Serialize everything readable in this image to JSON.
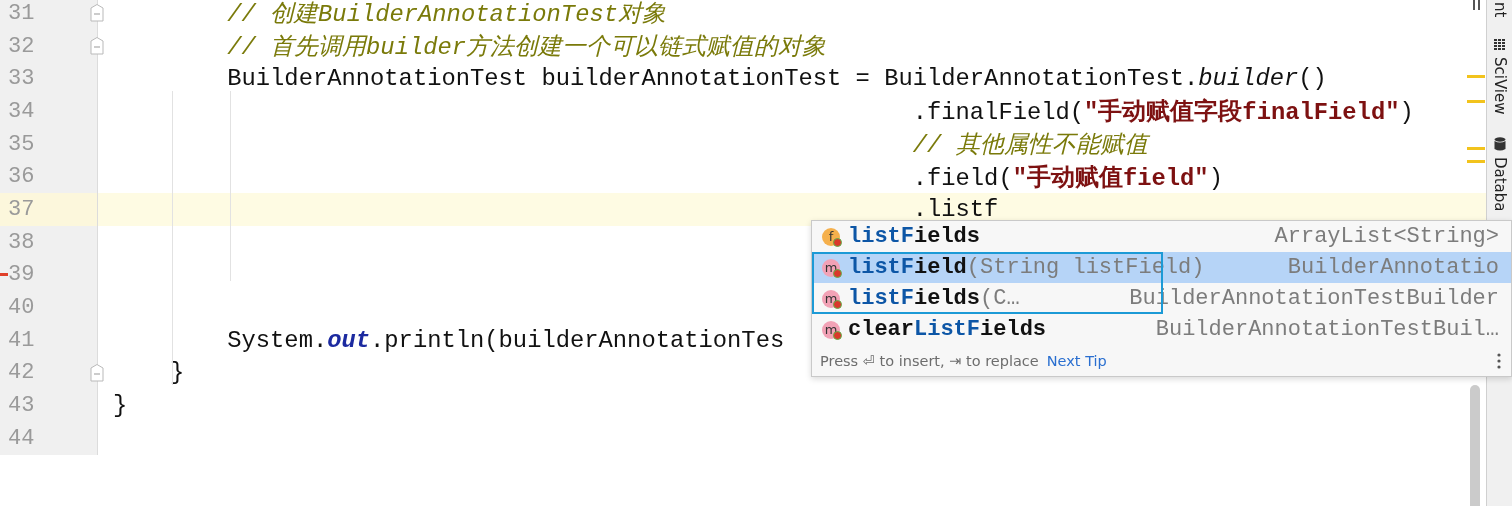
{
  "editor": {
    "lines": [
      {
        "number": "31",
        "current": false,
        "fold_marker": true,
        "change_marker": false,
        "tokens": [
          {
            "kind": "comment",
            "text": "        // 创建BuilderAnnotationTest对象"
          }
        ]
      },
      {
        "number": "32",
        "current": false,
        "fold_marker": true,
        "change_marker": false,
        "tokens": [
          {
            "kind": "comment",
            "text": "        // 首先调用builder方法创建一个可以链式赋值的对象"
          }
        ]
      },
      {
        "number": "33",
        "current": false,
        "fold_marker": false,
        "change_marker": false,
        "tokens": [
          {
            "kind": "plain",
            "text": "        BuilderAnnotationTest builderAnnotationTest = BuilderAnnotationTest."
          },
          {
            "kind": "method",
            "text": "builder"
          },
          {
            "kind": "plain",
            "text": "()"
          }
        ]
      },
      {
        "number": "34",
        "current": false,
        "fold_marker": false,
        "change_marker": false,
        "tokens": [
          {
            "kind": "plain",
            "text": "                                                        .finalField("
          },
          {
            "kind": "string",
            "text": "\"手动赋值字段finalField\""
          },
          {
            "kind": "plain",
            "text": ")"
          }
        ]
      },
      {
        "number": "35",
        "current": false,
        "fold_marker": false,
        "change_marker": false,
        "tokens": [
          {
            "kind": "comment",
            "text": "                                                        // 其他属性不能赋值"
          }
        ]
      },
      {
        "number": "36",
        "current": false,
        "fold_marker": false,
        "change_marker": false,
        "tokens": [
          {
            "kind": "plain",
            "text": "                                                        .field("
          },
          {
            "kind": "string",
            "text": "\"手动赋值field\""
          },
          {
            "kind": "plain",
            "text": ")"
          }
        ]
      },
      {
        "number": "37",
        "current": true,
        "fold_marker": false,
        "change_marker": false,
        "tokens": [
          {
            "kind": "plain",
            "text": "                                                        .listf"
          }
        ]
      },
      {
        "number": "38",
        "current": false,
        "fold_marker": false,
        "change_marker": false
      },
      {
        "number": "39",
        "current": false,
        "fold_marker": false,
        "change_marker": true
      },
      {
        "number": "40",
        "current": false,
        "fold_marker": false,
        "change_marker": false
      },
      {
        "number": "41",
        "current": false,
        "fold_marker": false,
        "change_marker": false,
        "tokens": [
          {
            "kind": "plain",
            "text": "        System."
          },
          {
            "kind": "static",
            "text": "out"
          },
          {
            "kind": "plain",
            "text": ".println(builderAnnotationTes"
          }
        ]
      },
      {
        "number": "42",
        "current": false,
        "fold_marker": true,
        "change_marker": false,
        "tokens": [
          {
            "kind": "plain",
            "text": "    }"
          }
        ]
      },
      {
        "number": "43",
        "current": false,
        "fold_marker": false,
        "change_marker": false,
        "tokens": [
          {
            "kind": "plain",
            "text": "}"
          }
        ]
      },
      {
        "number": "44",
        "current": false,
        "fold_marker": false,
        "change_marker": false
      }
    ]
  },
  "completion": {
    "items": [
      {
        "kind": "field",
        "icon_letter": "f",
        "selected": false,
        "framed": false,
        "name": [
          {
            "text": "listF",
            "matched": true
          },
          {
            "text": "ields",
            "matched": false
          }
        ],
        "type": "ArrayList<String>"
      },
      {
        "kind": "method",
        "icon_letter": "m",
        "selected": true,
        "framed": true,
        "name": [
          {
            "text": "listF",
            "matched": true
          },
          {
            "text": "ield",
            "matched": false
          }
        ],
        "params": "(String listField)",
        "type": "BuilderAnnotatio"
      },
      {
        "kind": "method",
        "icon_letter": "m",
        "selected": false,
        "framed": true,
        "name": [
          {
            "text": "listF",
            "matched": true
          },
          {
            "text": "ields",
            "matched": false
          }
        ],
        "params": "(C…",
        "type": "BuilderAnnotationTestBuilder"
      },
      {
        "kind": "method",
        "icon_letter": "m",
        "selected": false,
        "framed": false,
        "name": [
          {
            "text": "clear",
            "matched": false
          },
          {
            "text": "ListF",
            "matched": true
          },
          {
            "text": "ields",
            "matched": false
          }
        ],
        "type": "BuilderAnnotationTestBuil…"
      }
    ],
    "hint": "Press ⏎ to insert, ⇥ to replace",
    "tip_link": "Next Tip"
  },
  "tool_strip": {
    "tabs": [
      {
        "label": "nt"
      },
      {
        "label": "SciView"
      },
      {
        "label": "Databa"
      }
    ]
  }
}
